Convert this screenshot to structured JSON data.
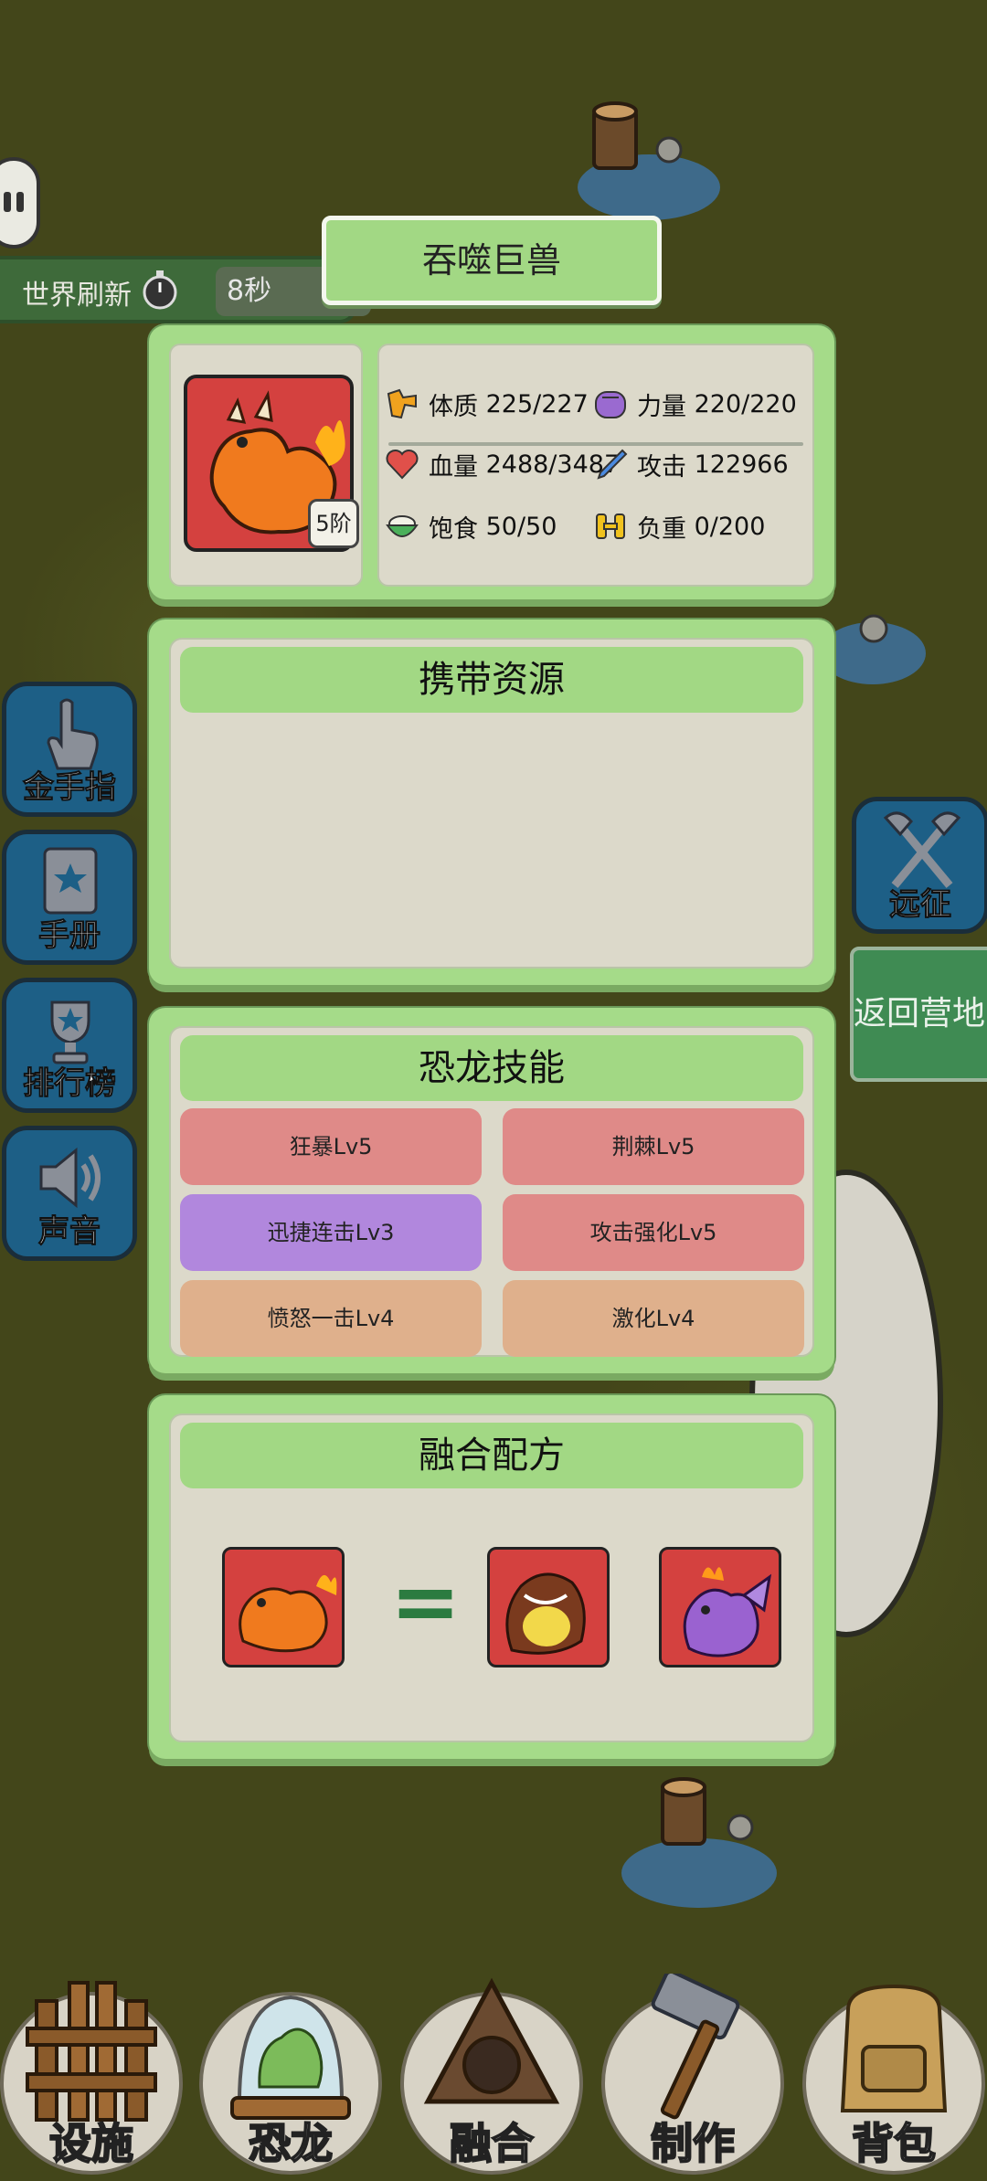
{
  "world_refresh": {
    "label": "世界刷新",
    "value": "8秒"
  },
  "creature_title": "吞噬巨兽",
  "avatar": {
    "tier": "5阶"
  },
  "stats": {
    "constitution": {
      "label": "体质",
      "value": "225/227"
    },
    "strength": {
      "label": "力量",
      "value": "220/220"
    },
    "hp": {
      "label": "血量",
      "value": "2488/3487"
    },
    "attack": {
      "label": "攻击",
      "value": "122966"
    },
    "satiety": {
      "label": "饱食",
      "value": "50/50"
    },
    "load": {
      "label": "负重",
      "value": "0/200"
    }
  },
  "resources": {
    "title": "携带资源"
  },
  "skills": {
    "title": "恐龙技能",
    "items": [
      {
        "label": "狂暴Lv5",
        "color": "#df8a88"
      },
      {
        "label": "荆棘Lv5",
        "color": "#df8a88"
      },
      {
        "label": "迅捷连击Lv3",
        "color": "#b187dd"
      },
      {
        "label": "攻击强化Lv5",
        "color": "#df8a88"
      },
      {
        "label": "愤怒一击Lv4",
        "color": "#dfb08c"
      },
      {
        "label": "激化Lv4",
        "color": "#dfb08c"
      }
    ]
  },
  "fusion": {
    "title": "融合配方",
    "equals": "="
  },
  "left_menu": [
    "金手指",
    "手册",
    "排行榜",
    "声音"
  ],
  "right_menu": {
    "expedition": "远征",
    "return": "返回营地"
  },
  "bottom_nav": [
    "设施",
    "恐龙",
    "融合",
    "制作",
    "背包"
  ],
  "colors": {
    "panel_green": "#a5db89",
    "panel_inner": "#dcd9ca",
    "button_blue": "#1d5f86",
    "fusion_equals": "#2b7b40"
  }
}
